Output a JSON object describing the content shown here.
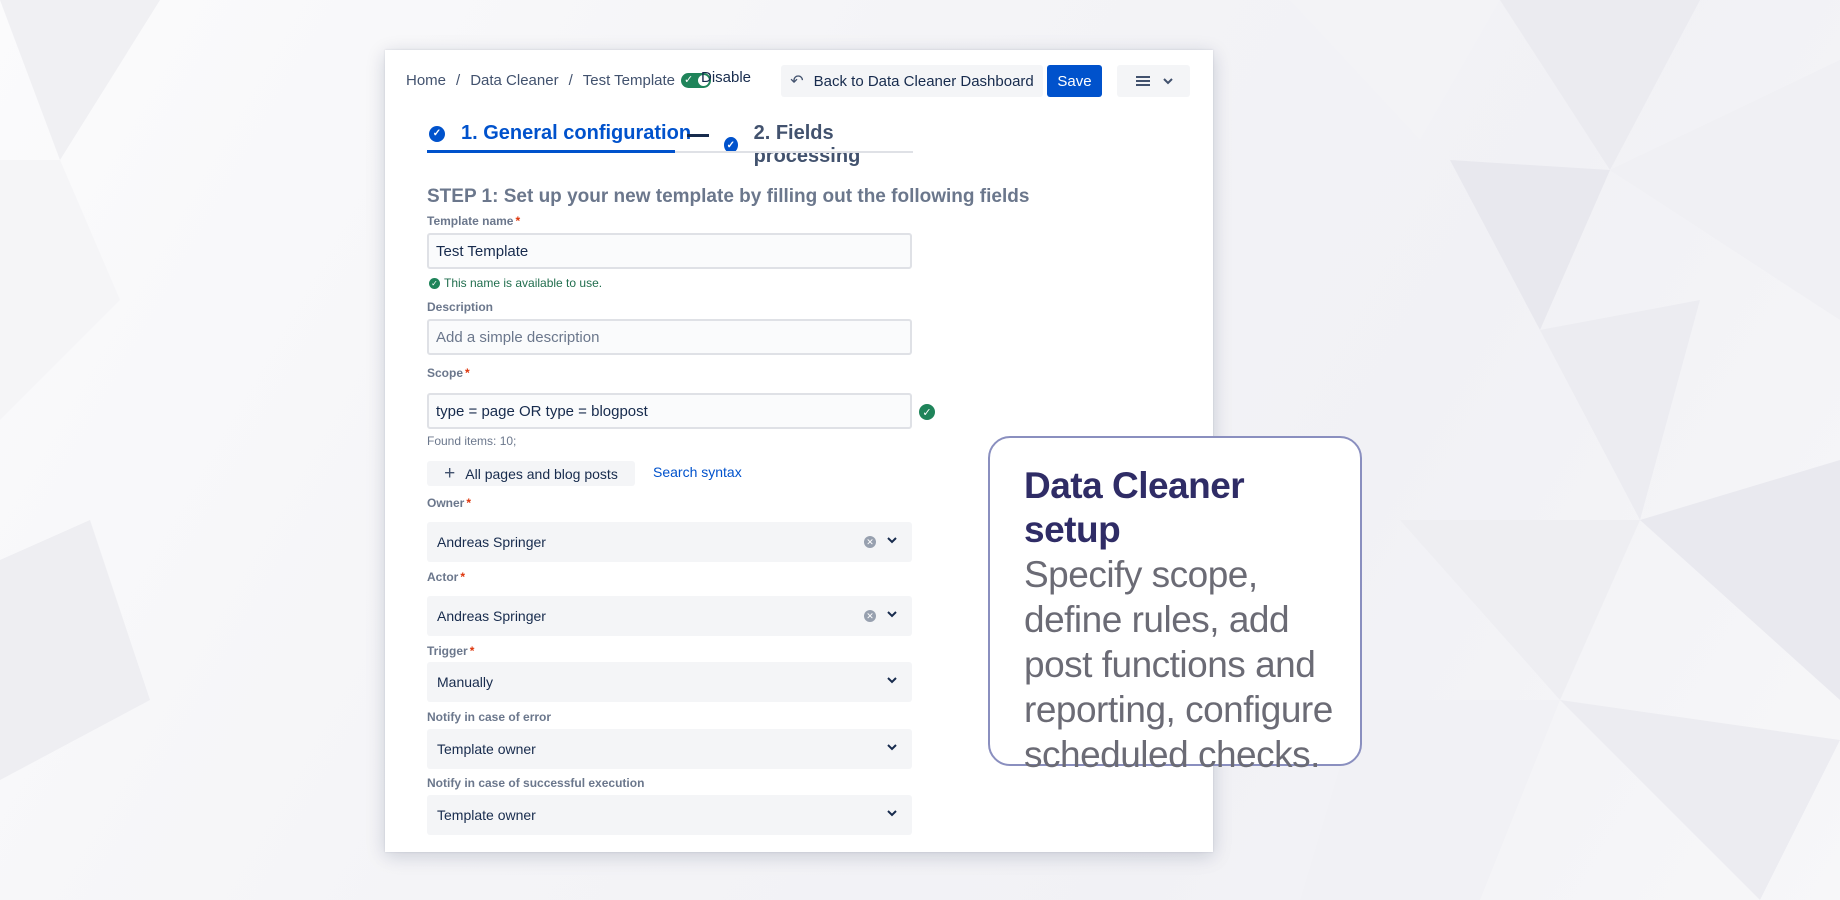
{
  "breadcrumbs": [
    "Home",
    "Data Cleaner",
    "Test Template"
  ],
  "breadcrumb_separator": "/",
  "toggle": {
    "label": "Disable",
    "on": true
  },
  "toolbar": {
    "back_label": "Back to Data Cleaner Dashboard",
    "save_label": "Save"
  },
  "steps": [
    {
      "label": "1. General configuration",
      "active": true
    },
    {
      "label": "2. Fields processing",
      "active": false
    }
  ],
  "form": {
    "heading": "STEP 1: Set up your new template by filling out the following fields",
    "template_name": {
      "label": "Template name",
      "value": "Test Template",
      "help": "This name is available to use."
    },
    "description": {
      "label": "Description",
      "placeholder": "Add a simple description"
    },
    "scope": {
      "label": "Scope",
      "value": "type = page OR type = blogpost",
      "found": "Found items: 10;",
      "all_button": "All pages and blog posts",
      "syntax_link": "Search syntax"
    },
    "owner": {
      "label": "Owner",
      "value": "Andreas Springer"
    },
    "actor": {
      "label": "Actor",
      "value": "Andreas Springer"
    },
    "trigger": {
      "label": "Trigger",
      "value": "Manually"
    },
    "notify_error": {
      "label": "Notify in case of error",
      "value": "Template owner"
    },
    "notify_success": {
      "label": "Notify in case of successful execution",
      "value": "Template owner"
    },
    "required_mark": "*"
  },
  "callout": {
    "title": "Data Cleaner setup",
    "body": "Specify scope, define rules, add post functions and reporting, configure scheduled checks."
  },
  "colors": {
    "primary": "#0052cc",
    "success": "#1f845a",
    "required": "#de350b",
    "callout_title": "#2f2c66",
    "callout_border": "#8a8fbf"
  }
}
